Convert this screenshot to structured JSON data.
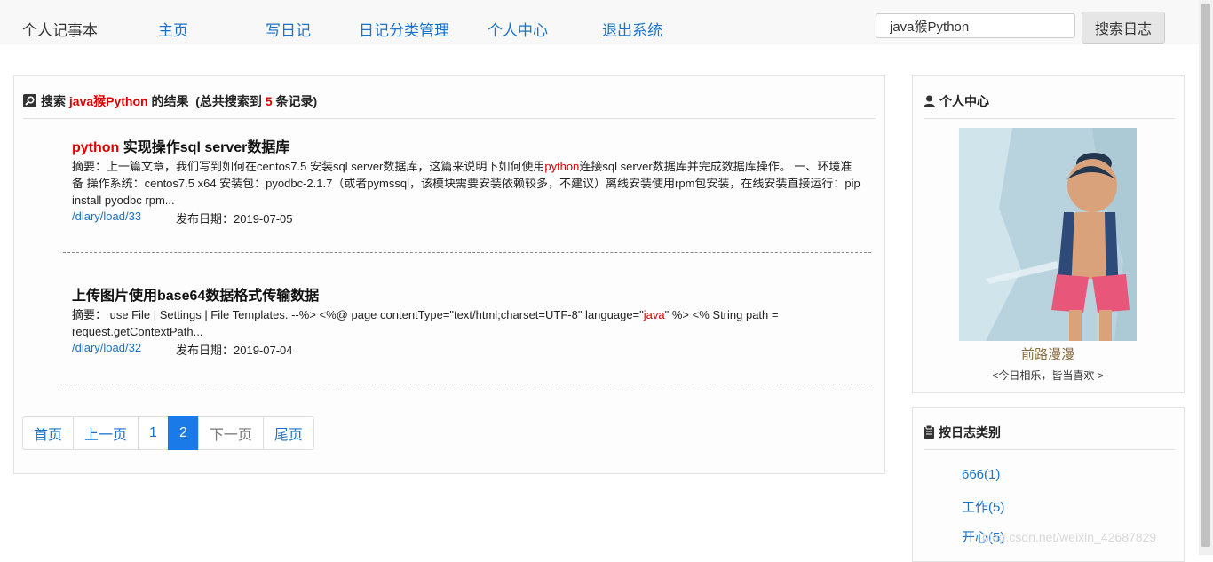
{
  "nav": {
    "brand": "个人记事本",
    "links": [
      "主页",
      "写日记",
      "日记分类管理",
      "个人中心",
      "退出系统"
    ],
    "search_value": "java猴Python",
    "search_button": "搜索日志"
  },
  "results": {
    "prefix": "搜索",
    "keyword": "java猴Python",
    "middle": "的结果",
    "total_prefix": "(总共搜索到",
    "total_count": "5",
    "total_suffix": "条记录)",
    "items": [
      {
        "title_hl": "python",
        "title_rest": " 实现操作sql server数据库",
        "summary_a": "摘要：上一篇文章，我们写到如何在centos7.5 安装sql server数据库，这篇来说明下如何使用",
        "summary_hl": "python",
        "summary_b": "连接sql server数据库并完成数据库操作。 一、环境准备 操作系统：centos7.5 x64 安装包：pyodbc-2.1.7（或者pymssql，该模块需要安装依赖较多，不建议）离线安装使用rpm包安装，在线安装直接运行：pip install pyodbc  rpm...",
        "link": "/diary/load/33",
        "date": "发布日期：2019-07-05"
      },
      {
        "title_hl": "",
        "title_rest": "上传图片使用base64数据格式传输数据",
        "summary_a": "摘要： use File | Settings | File Templates. --%> <%@ page contentType=\"text/html;charset=UTF-8\" language=\"",
        "summary_hl": "java",
        "summary_b": "\" %> <% String path = request.getContextPath...",
        "link": "/diary/load/32",
        "date": "发布日期：2019-07-04"
      }
    ]
  },
  "pagination": [
    "首页",
    "上一页",
    "1",
    "2",
    "下一页",
    "尾页"
  ],
  "profile": {
    "heading": "个人中心",
    "name": "前路漫漫",
    "motto": "<今日相乐，皆当喜欢 >"
  },
  "categories": {
    "heading": "按日志类别",
    "items": [
      "666(1)",
      "工作(5)",
      "开心(5)"
    ]
  },
  "watermark": "blog.csdn.net/weixin_42687829",
  "colors": {
    "link": "#1a73c9",
    "highlight": "#dd0000",
    "active_page": "#1a7ae8"
  }
}
